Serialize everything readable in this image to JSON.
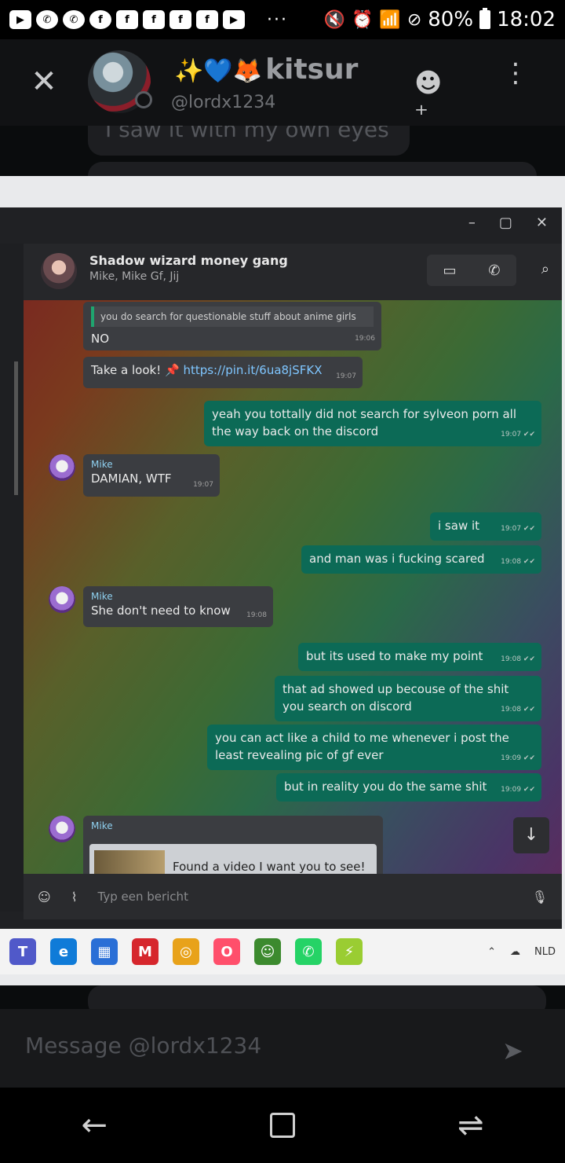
{
  "status_bar": {
    "notif_icons": [
      "▶",
      "✆",
      "✆",
      "f",
      "f",
      "f",
      "f",
      "f",
      "▶"
    ],
    "more": "···",
    "battery": "80%",
    "time": "18:02"
  },
  "header": {
    "display_name": "kitsur",
    "display_emoji": "✨💙🦊",
    "handle": "@lordx1234",
    "close_glyph": "✕",
    "add_friend_glyph": "☻⁺",
    "menu_glyph": "⋮"
  },
  "background_message": "I saw it with my own eyes",
  "attachment": {
    "window_controls": [
      "–",
      "▢",
      "✕"
    ],
    "chat": {
      "group_name": "Shadow wizard money gang",
      "members": "Mike, Mike Gf, Jij",
      "quoted": "you do search for questionable stuff about anime girls",
      "messages": [
        {
          "dir": "in",
          "text": "NO",
          "time": "19:06"
        },
        {
          "dir": "in",
          "text": "Take a look! 📌",
          "link": "https://pin.it/6ua8jSFKX",
          "time": "19:07"
        },
        {
          "dir": "out",
          "text": "yeah you tottally did not search for sylveon porn all the way back on the discord",
          "time": "19:07 ✔✔"
        },
        {
          "dir": "in",
          "sender": "Mike",
          "text": "DAMIAN, WTF",
          "time": "19:07"
        },
        {
          "dir": "out",
          "text": "i saw it",
          "time": "19:07 ✔✔"
        },
        {
          "dir": "out",
          "text": "and man was i fucking scared",
          "time": "19:08 ✔✔"
        },
        {
          "dir": "in",
          "sender": "Mike",
          "text": "She don't need to know",
          "time": "19:08"
        },
        {
          "dir": "out",
          "text": "but its used to make my point",
          "time": "19:08 ✔✔"
        },
        {
          "dir": "out",
          "text": "that ad showed up becouse of the shit you search on discord",
          "time": "19:08 ✔✔"
        },
        {
          "dir": "out",
          "text": "you can act like a child to me whenever i post the least revealing pic of gf ever",
          "time": "19:09 ✔✔"
        },
        {
          "dir": "out",
          "text": "but in reality you do the same shit",
          "time": "19:09 ✔✔"
        },
        {
          "dir": "in",
          "sender": "Mike",
          "text": "Found a video I want you to see!",
          "time": ""
        }
      ],
      "composer_placeholder": "Typ een bericht",
      "scroll_down_glyph": "↓"
    },
    "taskbar": {
      "apps": [
        "T",
        "e",
        "▦",
        "M",
        "◎",
        "O",
        "☺",
        "✆",
        "⚡"
      ],
      "tray": [
        "⌃",
        "☁",
        "NLD"
      ]
    }
  },
  "message_input": {
    "placeholder": "Message @lordx1234",
    "send_glyph": "➤"
  },
  "nav": {
    "back": "←",
    "home": "",
    "recents": "⇌"
  }
}
